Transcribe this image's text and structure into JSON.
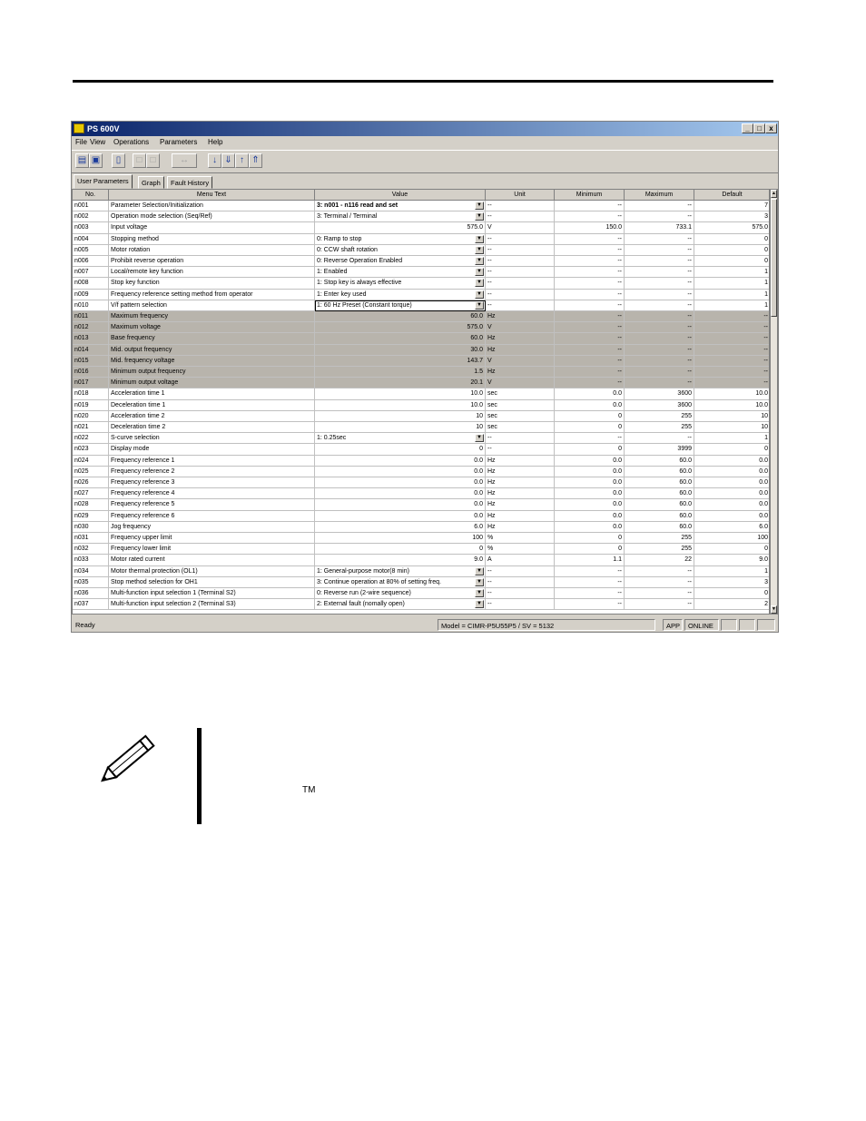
{
  "window": {
    "title": "PS 600V",
    "controls": {
      "minimize": "_",
      "restore": "□",
      "close": "x"
    }
  },
  "menu": [
    "File",
    "View",
    "Operations",
    "Parameters",
    "Help"
  ],
  "toolbar_icons": [
    "open-icon",
    "save-icon",
    "print-icon",
    "copy-icon",
    "paste-icon",
    "compare-icon",
    "download-icon",
    "read-all-icon",
    "upload-icon",
    "write-all-icon"
  ],
  "tabs": [
    "User Parameters",
    "Graph",
    "Fault History"
  ],
  "columns": [
    "No.",
    "Menu Text",
    "Value",
    "Unit",
    "Minimum",
    "Maximum",
    "Default"
  ],
  "rows": [
    {
      "no": "n001",
      "text": "Parameter Selection/Initialization",
      "value": "3: n001 - n116 read and set",
      "unit": "--",
      "min": "--",
      "max": "--",
      "def": "7",
      "dd": true,
      "bold": true,
      "ro": false
    },
    {
      "no": "n002",
      "text": "Operation mode selection (Seq/Ref)",
      "value": "3: Terminal / Terminal",
      "unit": "--",
      "min": "--",
      "max": "--",
      "def": "3",
      "dd": true,
      "ro": false
    },
    {
      "no": "n003",
      "text": "Input voltage",
      "value": "575.0",
      "unit": "V",
      "min": "150.0",
      "max": "733.1",
      "def": "575.0",
      "num": true,
      "ro": false
    },
    {
      "no": "n004",
      "text": "Stopping method",
      "value": "0: Ramp to stop",
      "unit": "--",
      "min": "--",
      "max": "--",
      "def": "0",
      "dd": true,
      "ro": false
    },
    {
      "no": "n005",
      "text": "Motor rotation",
      "value": "0: CCW shaft rotation",
      "unit": "--",
      "min": "--",
      "max": "--",
      "def": "0",
      "dd": true,
      "ro": false
    },
    {
      "no": "n006",
      "text": "Prohibit reverse operation",
      "value": "0: Reverse Operation Enabled",
      "unit": "--",
      "min": "--",
      "max": "--",
      "def": "0",
      "dd": true,
      "ro": false
    },
    {
      "no": "n007",
      "text": "Local/remote key function",
      "value": "1: Enabled",
      "unit": "--",
      "min": "--",
      "max": "--",
      "def": "1",
      "dd": true,
      "ro": false
    },
    {
      "no": "n008",
      "text": "Stop key function",
      "value": "1: Stop key is always effective",
      "unit": "--",
      "min": "--",
      "max": "--",
      "def": "1",
      "dd": true,
      "ro": false
    },
    {
      "no": "n009",
      "text": "Frequency reference setting method from operator",
      "value": "1: Enter key used",
      "unit": "--",
      "min": "--",
      "max": "--",
      "def": "1",
      "dd": true,
      "ro": false
    },
    {
      "no": "n010",
      "text": "V/f pattern selection",
      "value": "1: 60 Hz Preset (Constant torque)",
      "unit": "--",
      "min": "--",
      "max": "--",
      "def": "1",
      "dd": true,
      "sel": true,
      "ro": false
    },
    {
      "no": "n011",
      "text": "Maximum frequency",
      "value": "60.0",
      "unit": "Hz",
      "min": "--",
      "max": "--",
      "def": "--",
      "num": true,
      "ro": true
    },
    {
      "no": "n012",
      "text": "Maximum voltage",
      "value": "575.0",
      "unit": "V",
      "min": "--",
      "max": "--",
      "def": "--",
      "num": true,
      "ro": true
    },
    {
      "no": "n013",
      "text": "Base frequency",
      "value": "60.0",
      "unit": "Hz",
      "min": "--",
      "max": "--",
      "def": "--",
      "num": true,
      "ro": true
    },
    {
      "no": "n014",
      "text": "Mid. output frequency",
      "value": "30.0",
      "unit": "Hz",
      "min": "--",
      "max": "--",
      "def": "--",
      "num": true,
      "ro": true
    },
    {
      "no": "n015",
      "text": "Mid. frequency voltage",
      "value": "143.7",
      "unit": "V",
      "min": "--",
      "max": "--",
      "def": "--",
      "num": true,
      "ro": true
    },
    {
      "no": "n016",
      "text": "Minimum output frequency",
      "value": "1.5",
      "unit": "Hz",
      "min": "--",
      "max": "--",
      "def": "--",
      "num": true,
      "ro": true
    },
    {
      "no": "n017",
      "text": "Minimum output voltage",
      "value": "20.1",
      "unit": "V",
      "min": "--",
      "max": "--",
      "def": "--",
      "num": true,
      "ro": true
    },
    {
      "no": "n018",
      "text": "Acceleration time 1",
      "value": "10.0",
      "unit": "sec",
      "min": "0.0",
      "max": "3600",
      "def": "10.0",
      "num": true,
      "ro": false
    },
    {
      "no": "n019",
      "text": "Deceleration time 1",
      "value": "10.0",
      "unit": "sec",
      "min": "0.0",
      "max": "3600",
      "def": "10.0",
      "num": true,
      "ro": false
    },
    {
      "no": "n020",
      "text": "Acceleration time 2",
      "value": "10",
      "unit": "sec",
      "min": "0",
      "max": "255",
      "def": "10",
      "num": true,
      "ro": false
    },
    {
      "no": "n021",
      "text": "Deceleration time 2",
      "value": "10",
      "unit": "sec",
      "min": "0",
      "max": "255",
      "def": "10",
      "num": true,
      "ro": false
    },
    {
      "no": "n022",
      "text": "S-curve selection",
      "value": "1: 0.25sec",
      "unit": "--",
      "min": "--",
      "max": "--",
      "def": "1",
      "dd": true,
      "ro": false
    },
    {
      "no": "n023",
      "text": "Display mode",
      "value": "0",
      "unit": "--",
      "min": "0",
      "max": "3999",
      "def": "0",
      "num": true,
      "ro": false
    },
    {
      "no": "n024",
      "text": "Frequency reference 1",
      "value": "0.0",
      "unit": "Hz",
      "min": "0.0",
      "max": "60.0",
      "def": "0.0",
      "num": true,
      "ro": false
    },
    {
      "no": "n025",
      "text": "Frequency reference 2",
      "value": "0.0",
      "unit": "Hz",
      "min": "0.0",
      "max": "60.0",
      "def": "0.0",
      "num": true,
      "ro": false
    },
    {
      "no": "n026",
      "text": "Frequency reference 3",
      "value": "0.0",
      "unit": "Hz",
      "min": "0.0",
      "max": "60.0",
      "def": "0.0",
      "num": true,
      "ro": false
    },
    {
      "no": "n027",
      "text": "Frequency reference 4",
      "value": "0.0",
      "unit": "Hz",
      "min": "0.0",
      "max": "60.0",
      "def": "0.0",
      "num": true,
      "ro": false
    },
    {
      "no": "n028",
      "text": "Frequency reference 5",
      "value": "0.0",
      "unit": "Hz",
      "min": "0.0",
      "max": "60.0",
      "def": "0.0",
      "num": true,
      "ro": false
    },
    {
      "no": "n029",
      "text": "Frequency reference 6",
      "value": "0.0",
      "unit": "Hz",
      "min": "0.0",
      "max": "60.0",
      "def": "0.0",
      "num": true,
      "ro": false
    },
    {
      "no": "n030",
      "text": "Jog frequency",
      "value": "6.0",
      "unit": "Hz",
      "min": "0.0",
      "max": "60.0",
      "def": "6.0",
      "num": true,
      "ro": false
    },
    {
      "no": "n031",
      "text": "Frequency upper limit",
      "value": "100",
      "unit": "%",
      "min": "0",
      "max": "255",
      "def": "100",
      "num": true,
      "ro": false
    },
    {
      "no": "n032",
      "text": "Frequency lower limit",
      "value": "0",
      "unit": "%",
      "min": "0",
      "max": "255",
      "def": "0",
      "num": true,
      "ro": false
    },
    {
      "no": "n033",
      "text": "Motor rated current",
      "value": "9.0",
      "unit": "A",
      "min": "1.1",
      "max": "22",
      "def": "9.0",
      "num": true,
      "ro": false
    },
    {
      "no": "n034",
      "text": "Motor thermal protection (OL1)",
      "value": "1: General-purpose motor(8 min)",
      "unit": "--",
      "min": "--",
      "max": "--",
      "def": "1",
      "dd": true,
      "ro": false
    },
    {
      "no": "n035",
      "text": "Stop method selection for OH1",
      "value": "3: Continue operation at 80% of setting freq.",
      "unit": "--",
      "min": "--",
      "max": "--",
      "def": "3",
      "dd": true,
      "ro": false
    },
    {
      "no": "n036",
      "text": "Multi-function input selection 1 (Terminal S2)",
      "value": "0: Reverse run (2-wire sequence)",
      "unit": "--",
      "min": "--",
      "max": "--",
      "def": "0",
      "dd": true,
      "ro": false
    },
    {
      "no": "n037",
      "text": "Multi-function input selection 2 (Terminal S3)",
      "value": "2: External fault (nomally open)",
      "unit": "--",
      "min": "--",
      "max": "--",
      "def": "2",
      "dd": true,
      "ro": false
    }
  ],
  "status": {
    "left": "Ready",
    "model": "Model = CIMR-P5U55P5 / SV = 5132",
    "mode": "APP",
    "conn": "ONLINE"
  },
  "note": {
    "tm": "TM"
  }
}
